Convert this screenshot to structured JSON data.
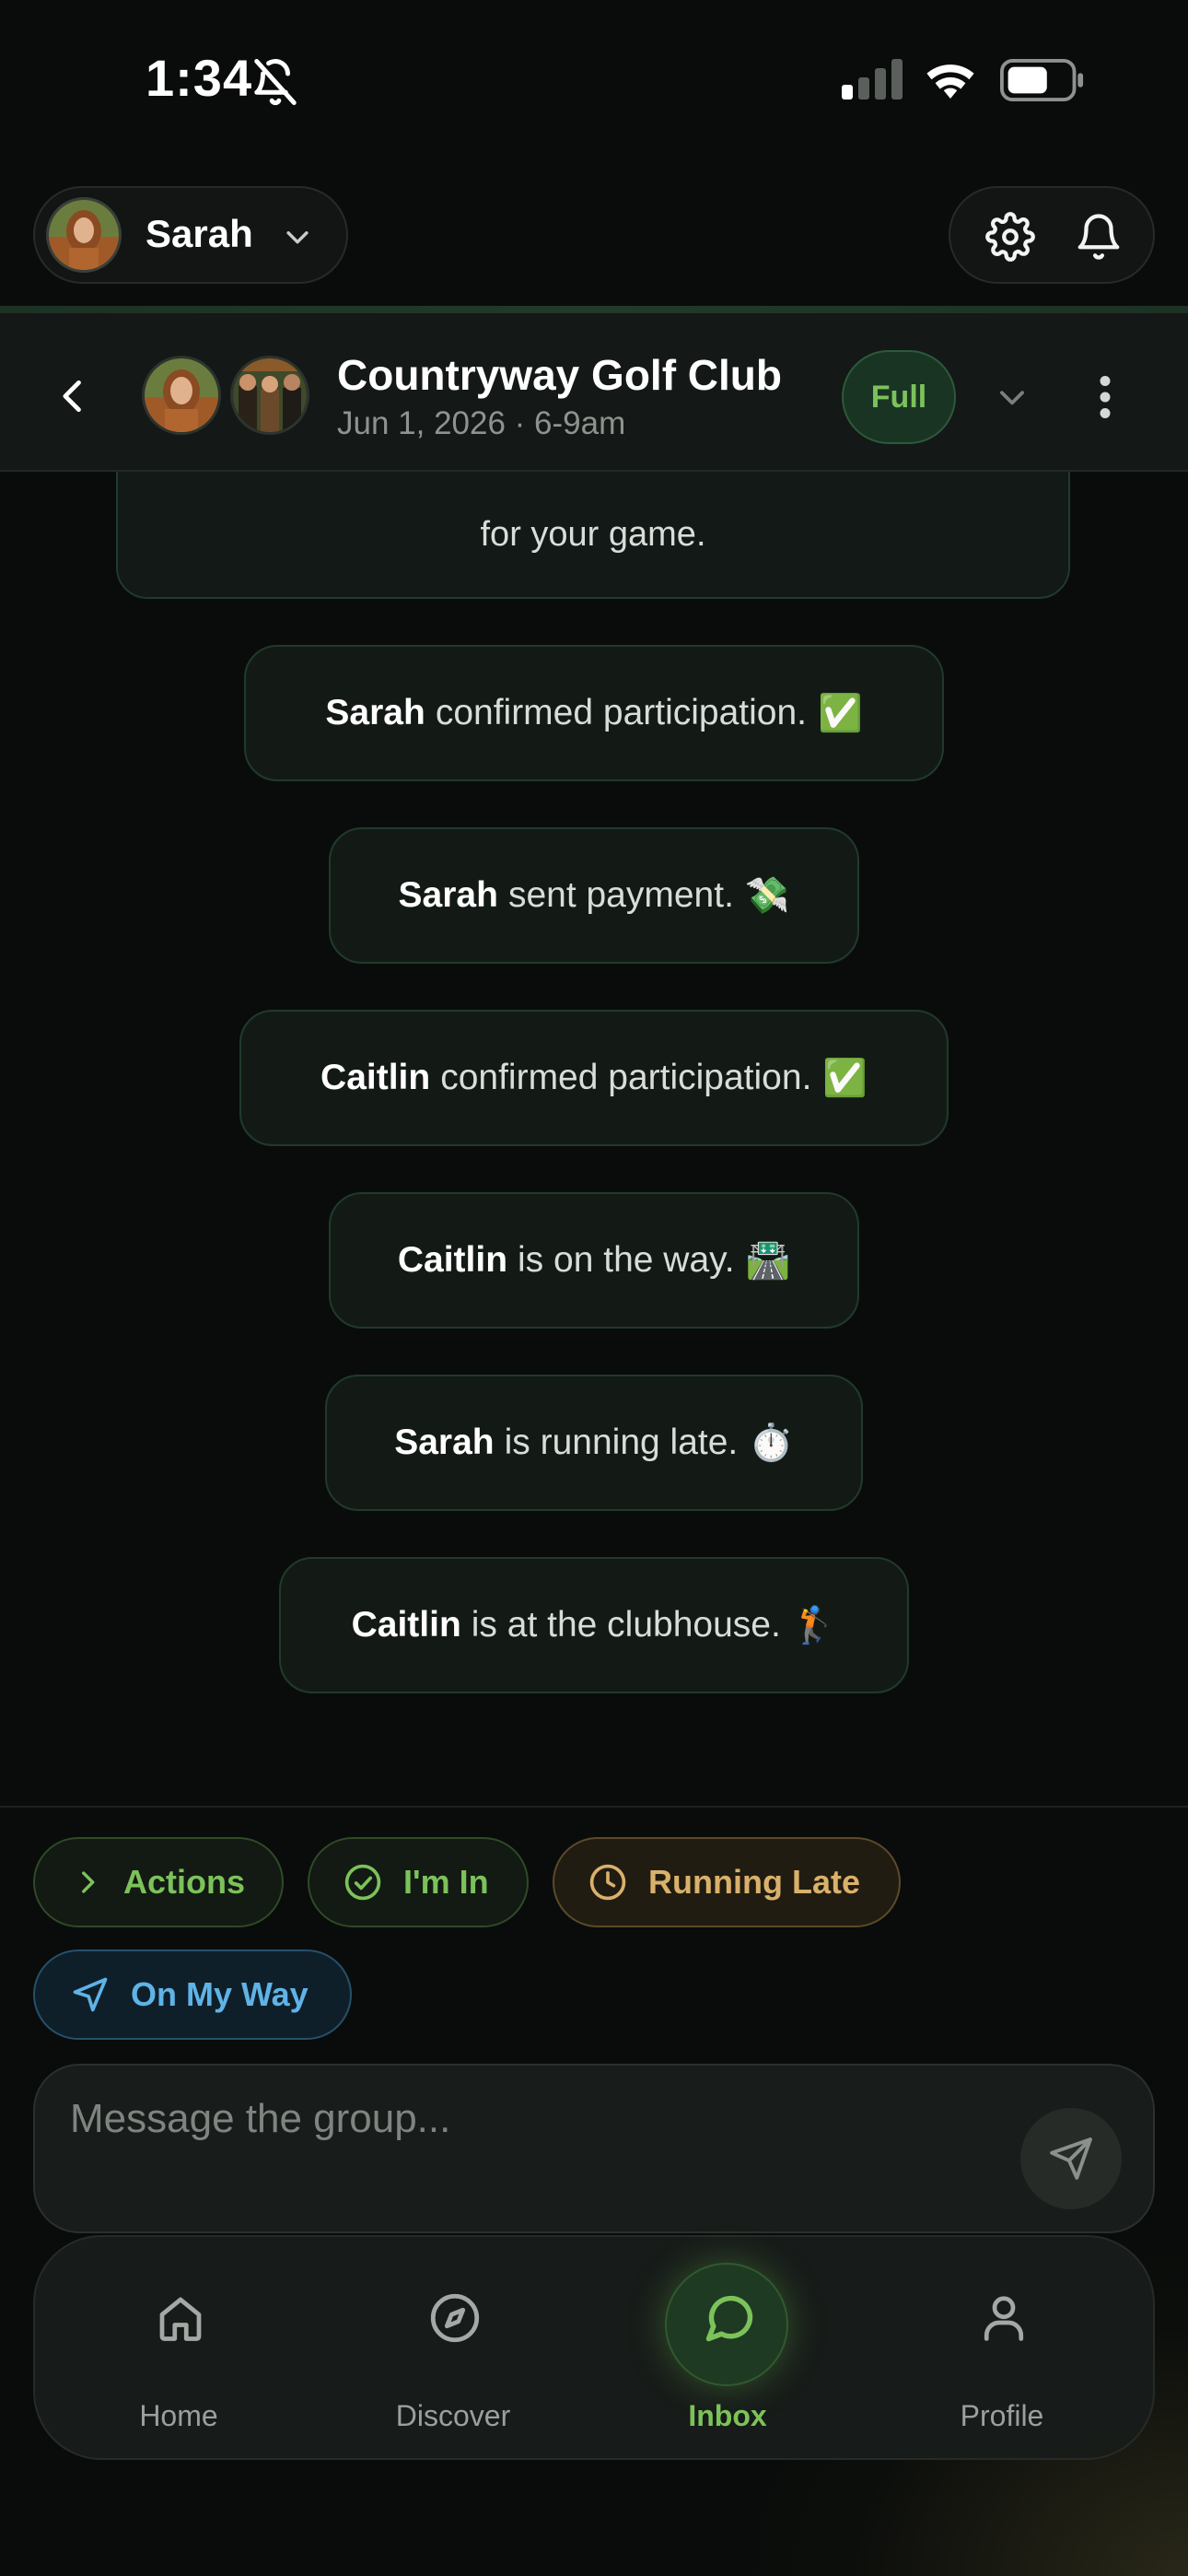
{
  "status_bar": {
    "time": "1:34"
  },
  "top_bar": {
    "user_name": "Sarah"
  },
  "chat": {
    "title": "Countryway Golf Club",
    "subtitle": "Jun 1, 2026 · 6-9am",
    "status_badge": "Full"
  },
  "messages": {
    "top_card_text": "for your game.",
    "events": [
      {
        "name": "Sarah",
        "text": "confirmed participation.",
        "emoji": "✅"
      },
      {
        "name": "Sarah",
        "text": "sent payment.",
        "emoji": "💸"
      },
      {
        "name": "Caitlin",
        "text": "confirmed participation.",
        "emoji": "✅"
      },
      {
        "name": "Caitlin",
        "text": "is on the way.",
        "emoji": "🛣️"
      },
      {
        "name": "Sarah",
        "text": "is running late.",
        "emoji": "⏱️"
      },
      {
        "name": "Caitlin",
        "text": "is at the clubhouse.",
        "emoji": "🏌️"
      }
    ]
  },
  "quick_actions": {
    "actions": "Actions",
    "im_in": "I'm In",
    "running_late": "Running Late",
    "on_my_way": "On My Way"
  },
  "composer": {
    "placeholder": "Message the group..."
  },
  "nav": {
    "home": "Home",
    "discover": "Discover",
    "inbox": "Inbox",
    "profile": "Profile"
  },
  "colors": {
    "accent_green": "#7cc25a",
    "late_amber": "#d9b16a",
    "way_blue": "#5fb3e6"
  }
}
